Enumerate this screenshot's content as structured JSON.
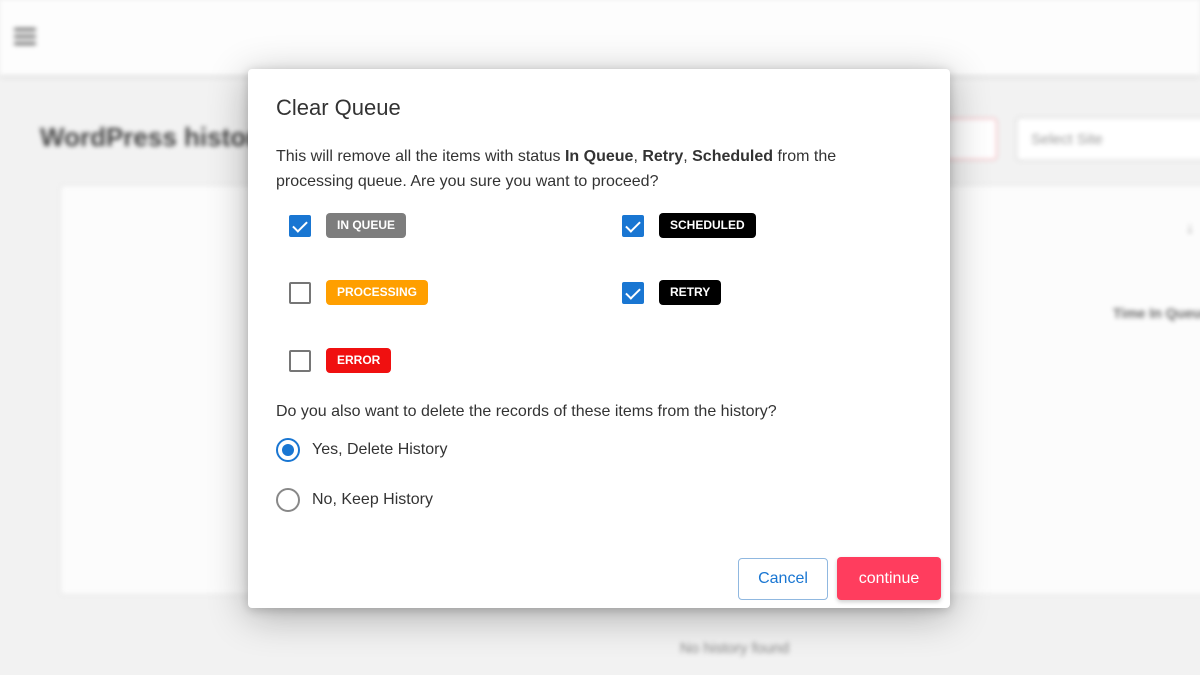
{
  "background": {
    "page_title": "WordPress history",
    "site_select_placeholder": "Select Site",
    "sort_glyph": "↓",
    "column_header": "Time In Queue",
    "empty_message": "No history found"
  },
  "dialog": {
    "title": "Clear Queue",
    "desc_before": "This will remove all the items with status ",
    "desc_status_1": "In Queue",
    "desc_sep_1": ", ",
    "desc_status_2": "Retry",
    "desc_sep_2": ", ",
    "desc_status_3": "Scheduled",
    "desc_after": " from the processing queue. Are you sure you want to proceed?",
    "statuses": [
      {
        "label": "IN QUEUE",
        "checked": true,
        "color": "#7d7d7d"
      },
      {
        "label": "PROCESSING",
        "checked": false,
        "color": "#ff9f00"
      },
      {
        "label": "ERROR",
        "checked": false,
        "color": "#f01010"
      },
      {
        "label": "SCHEDULED",
        "checked": true,
        "color": "#000000"
      },
      {
        "label": "RETRY",
        "checked": true,
        "color": "#000000"
      }
    ],
    "history_question": "Do you also want to delete the records of these items from the history?",
    "history_options": [
      {
        "label": "Yes, Delete History",
        "selected": true
      },
      {
        "label": "No, Keep History",
        "selected": false
      }
    ],
    "cancel_label": "Cancel",
    "continue_label": "continue"
  },
  "colors": {
    "accent": "#1976d2",
    "danger": "#ff3d5e"
  }
}
